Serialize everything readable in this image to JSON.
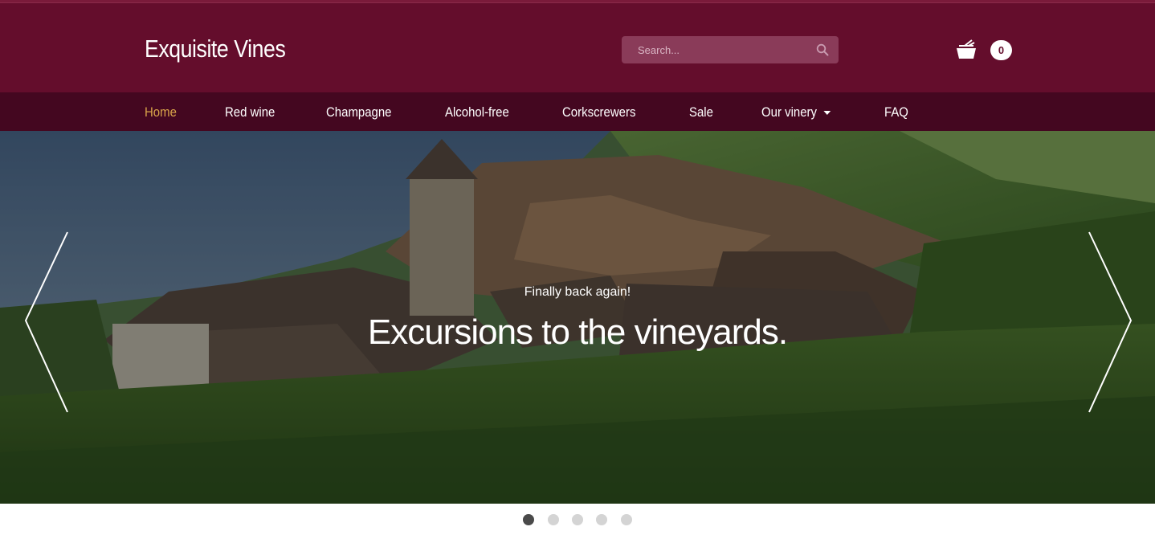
{
  "brand": {
    "name": "Exquisite Vines"
  },
  "search": {
    "placeholder": "Search..."
  },
  "cart": {
    "count": "0"
  },
  "nav": {
    "items": [
      {
        "label": "Home",
        "active": true
      },
      {
        "label": "Red wine"
      },
      {
        "label": "Champagne"
      },
      {
        "label": "Alcohol-free"
      },
      {
        "label": "Corkscrewers"
      },
      {
        "label": "Sale"
      },
      {
        "label": "Our vinery",
        "dropdown": true
      },
      {
        "label": "FAQ"
      }
    ]
  },
  "hero": {
    "subtitle": "Finally back again!",
    "title": "Excursions to the vineyards."
  },
  "slider": {
    "slide_count": 5,
    "active_index": 0
  },
  "icons": {
    "search": "search-icon",
    "cart": "cart-icon",
    "prev": "chevron-left-icon",
    "next": "chevron-right-icon",
    "dropdown": "caret-down-icon"
  },
  "colors": {
    "header": "#640d2c",
    "nav": "#440720",
    "active_nav": "#d9a44a",
    "dot_active": "#4a4a4a",
    "dot_inactive": "#d4d4d4"
  }
}
